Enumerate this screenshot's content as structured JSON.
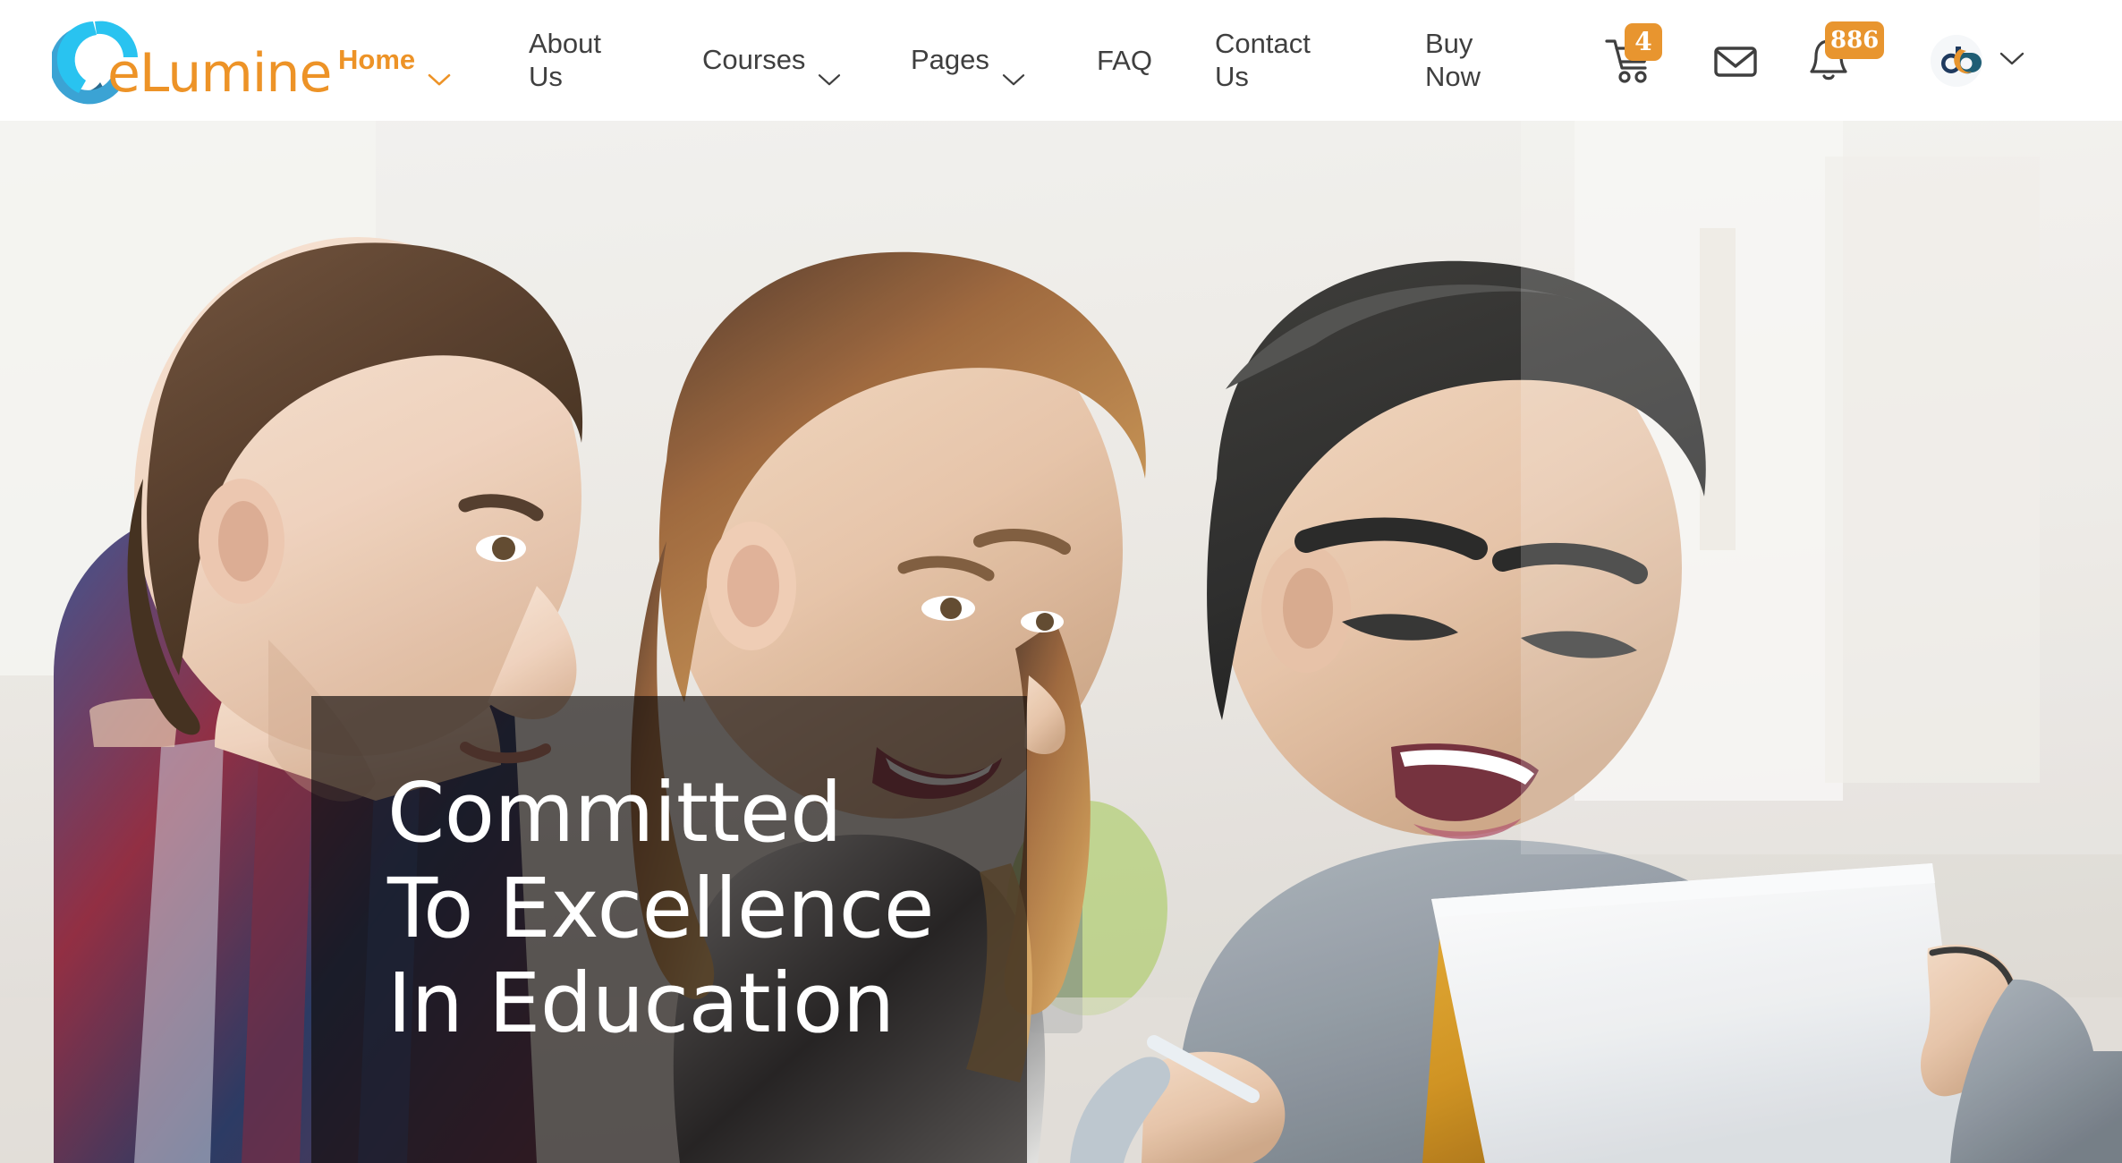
{
  "header": {
    "logo": {
      "text": "eLumine",
      "icon": "elumine-swirl-logo",
      "colors": [
        "#2A6B8F",
        "#3BA3D4",
        "#29C3F0",
        "#ED9327"
      ]
    },
    "nav": [
      {
        "label": "Home",
        "has_dropdown": true,
        "active": true
      },
      {
        "label": "About\nUs",
        "has_dropdown": false,
        "active": false
      },
      {
        "label": "Courses",
        "has_dropdown": true,
        "active": false
      },
      {
        "label": "Pages",
        "has_dropdown": true,
        "active": false
      },
      {
        "label": "FAQ",
        "has_dropdown": false,
        "active": false
      },
      {
        "label": "Contact\nUs",
        "has_dropdown": false,
        "active": false
      },
      {
        "label": "Buy\nNow",
        "has_dropdown": false,
        "active": false
      }
    ],
    "actions": {
      "cart": {
        "icon": "shopping-cart-icon",
        "badge": "4"
      },
      "mail": {
        "icon": "envelope-icon"
      },
      "notifications": {
        "icon": "bell-icon",
        "badge": "886"
      },
      "account": {
        "icon": "user-avatar-logo",
        "chevron": "chevron-down-icon"
      }
    },
    "accent_color": "#ED9327",
    "badge_color": "#E8952F",
    "text_color": "#3F3F3F"
  },
  "hero": {
    "image_alt": "three students smiling at a laptop",
    "overlay": {
      "heading": "Committed\nTo Excellence\nIn Education",
      "background_color": "rgba(16,12,10,0.66)",
      "text_color": "#FFFFFF"
    }
  }
}
